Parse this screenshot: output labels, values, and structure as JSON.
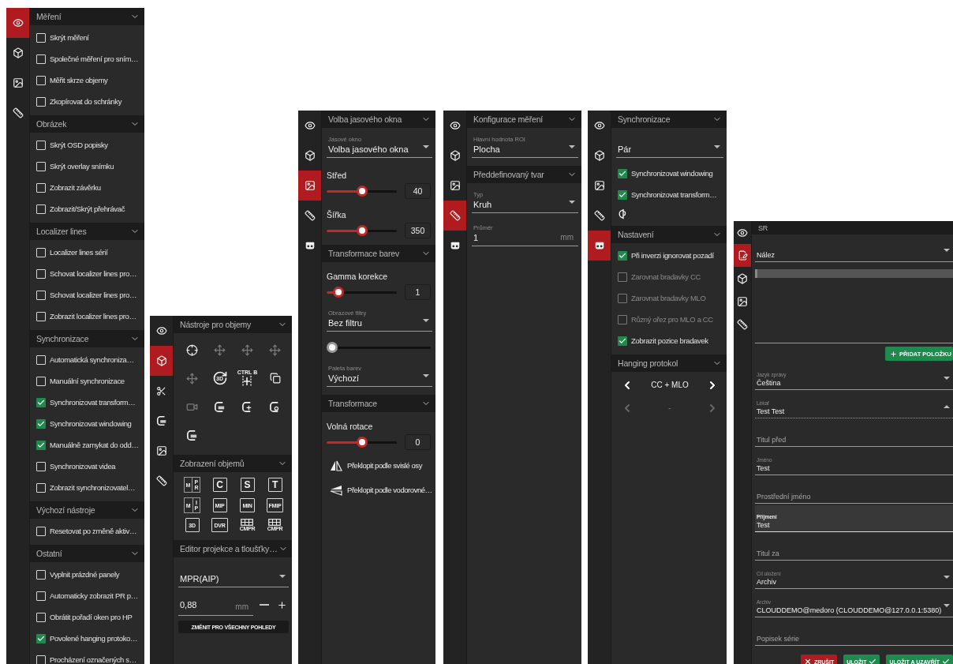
{
  "panels": [
    {
      "kind": "settings",
      "sidebar": [
        {
          "kind": "eye",
          "selected": true
        },
        {
          "kind": "cube",
          "selected": false
        },
        {
          "kind": "image",
          "selected": false
        },
        {
          "kind": "ruler",
          "selected": false
        }
      ],
      "sections": [
        {
          "title": "Měření",
          "items": [
            {
              "kind": "checkbox",
              "label": "Skrýt měření",
              "checked": false
            },
            {
              "kind": "checkbox",
              "label": "Společné měření pro sním…",
              "checked": false
            },
            {
              "kind": "checkbox",
              "label": "Měřit skrze objemy",
              "checked": false
            },
            {
              "kind": "checkbox",
              "label": "Zkopírovat do schránky",
              "checked": false
            }
          ]
        },
        {
          "title": "Obrázek",
          "items": [
            {
              "kind": "checkbox",
              "label": "Skrýt OSD popisky",
              "checked": false
            },
            {
              "kind": "checkbox",
              "label": "Skrýt overlay snímku",
              "checked": false
            },
            {
              "kind": "checkbox",
              "label": "Zobrazit závěrku",
              "checked": false
            },
            {
              "kind": "checkbox",
              "label": "Zobrazit/Skrýt přehrávač",
              "checked": false
            }
          ]
        },
        {
          "title": "Localizer lines",
          "items": [
            {
              "kind": "checkbox",
              "label": "Localizer lines sérií",
              "checked": false
            },
            {
              "kind": "checkbox",
              "label": "Schovat localizer lines pro…",
              "checked": false
            },
            {
              "kind": "checkbox",
              "label": "Schovat localizer lines pro…",
              "checked": false
            },
            {
              "kind": "checkbox",
              "label": "Zobrazit localizer lines pro…",
              "checked": false
            }
          ]
        },
        {
          "title": "Synchronizace",
          "items": [
            {
              "kind": "checkbox",
              "label": "Automatická synchroniza…",
              "checked": false
            },
            {
              "kind": "checkbox",
              "label": "Manuální synchronizace",
              "checked": false
            },
            {
              "kind": "checkbox",
              "label": "Synchronizovat transform…",
              "checked": true
            },
            {
              "kind": "checkbox",
              "label": "Synchronizovat windowing",
              "checked": true
            },
            {
              "kind": "checkbox",
              "label": "Manuálně zamykat do odd…",
              "checked": true
            },
            {
              "kind": "checkbox",
              "label": "Synchronizovat videa",
              "checked": false
            },
            {
              "kind": "checkbox",
              "label": "Zobrazit synchronizovatel…",
              "checked": false
            }
          ]
        },
        {
          "title": "Výchozí nástroje",
          "items": [
            {
              "kind": "checkbox",
              "label": "Resetovat po změně aktiv…",
              "checked": false
            }
          ]
        },
        {
          "title": "Ostatní",
          "items": [
            {
              "kind": "checkbox",
              "label": "Vyplnit prázdné panely",
              "checked": false
            },
            {
              "kind": "checkbox",
              "label": "Automaticky zobrazit PR p…",
              "checked": false
            },
            {
              "kind": "checkbox",
              "label": "Obrátit pořadí oken pro HP",
              "checked": false
            },
            {
              "kind": "checkbox",
              "label": "Povolené hanging protoko…",
              "checked": true
            },
            {
              "kind": "checkbox",
              "label": "Procházení označených s…",
              "checked": false
            }
          ]
        }
      ]
    },
    {
      "kind": "settings",
      "sidebar": [
        {
          "kind": "eye",
          "selected": false
        },
        {
          "kind": "cube",
          "selected": true
        },
        {
          "kind": "scissors",
          "selected": false
        },
        {
          "kind": "bracket",
          "selected": false
        },
        {
          "kind": "image",
          "selected": false
        },
        {
          "kind": "ruler",
          "selected": false
        }
      ],
      "sections": [
        {
          "title": "Nástroje pro objemy",
          "items": [
            {
              "kind": "tools",
              "tools": [
                {
                  "kind": "crosshair",
                  "disabled": false
                },
                {
                  "kind": "move",
                  "disabled": true
                },
                {
                  "kind": "move",
                  "disabled": true
                },
                {
                  "kind": "move",
                  "disabled": true
                },
                {
                  "kind": "move",
                  "disabled": true
                },
                {
                  "kind": "rotate",
                  "text": "3D",
                  "disabled": false
                },
                {
                  "kind": "split",
                  "caption": "CTRL B",
                  "disabled": false
                },
                {
                  "kind": "layers",
                  "disabled": false
                },
                {
                  "kind": "video",
                  "disabled": true
                },
                {
                  "kind": "curve",
                  "disabled": false
                },
                {
                  "kind": "curve",
                  "disabled": false
                },
                {
                  "kind": "curve",
                  "disabled": false
                },
                {
                  "kind": "curve",
                  "disabled": false
                }
              ]
            }
          ]
        },
        {
          "title": "Zobrazení objemů",
          "items": [
            {
              "kind": "tools",
              "tools": [
                {
                  "kind": "stacked",
                  "text": "M",
                  "stack": [
                    "P",
                    "R"
                  ]
                },
                {
                  "kind": "boxed",
                  "text": "C"
                },
                {
                  "kind": "boxed",
                  "text": "S"
                },
                {
                  "kind": "boxed",
                  "text": "T"
                },
                {
                  "kind": "stacked",
                  "text": "M",
                  "stack": [
                    "I",
                    "P"
                  ]
                },
                {
                  "kind": "boxed",
                  "text": "MIP"
                },
                {
                  "kind": "boxed",
                  "text": "MIN"
                },
                {
                  "kind": "boxed",
                  "text": "FMIP"
                },
                {
                  "kind": "boxed",
                  "text": "3D"
                },
                {
                  "kind": "boxed",
                  "text": "DVR"
                },
                {
                  "kind": "grid",
                  "text": "CMPR"
                },
                {
                  "kind": "grid",
                  "text": "CMPR"
                }
              ]
            }
          ]
        },
        {
          "title": "Editor projekce a tloušťky…",
          "items": [
            {
              "kind": "select",
              "value": "MPR(AIP)"
            },
            {
              "kind": "stepper",
              "value": "0,88",
              "unit": "mm"
            },
            {
              "kind": "button",
              "label": "ZMĚNIT PRO VŠECHNY POHLEDY"
            }
          ]
        }
      ]
    },
    {
      "kind": "settings",
      "sidebar": [
        {
          "kind": "eye",
          "selected": false
        },
        {
          "kind": "cube",
          "selected": false
        },
        {
          "kind": "image",
          "selected": true
        },
        {
          "kind": "ruler",
          "selected": false
        },
        {
          "kind": "mask",
          "selected": false
        }
      ],
      "sections": [
        {
          "title": "Volba jasového okna",
          "items": [
            {
              "kind": "select",
              "label": "Jasové okno",
              "value": "Volba jasového okna"
            },
            {
              "kind": "slider",
              "label": "Střed",
              "level": 0.5,
              "value": "40"
            },
            {
              "kind": "slider",
              "label": "Šířka",
              "level": 0.5,
              "value": "350"
            }
          ]
        },
        {
          "title": "Transformace barev",
          "items": [
            {
              "kind": "slider",
              "label": "Gamma korekce",
              "level": 0.1,
              "value": "1"
            },
            {
              "kind": "select",
              "label": "Obrazové filtry",
              "value": "Bez filtru"
            },
            {
              "kind": "slider",
              "level": 0
            },
            {
              "kind": "select",
              "label": "Paleta barev",
              "value": "Výchozí"
            }
          ]
        },
        {
          "title": "Transformace",
          "items": [
            {
              "kind": "slider",
              "label": "Volná rotace",
              "level": 0.5,
              "value": "0"
            },
            {
              "kind": "flip-vertical",
              "label": "Překlopit podle svislé osy"
            },
            {
              "kind": "flip-horizontal",
              "label": "Překlopit podle vodorovné…"
            }
          ]
        }
      ]
    },
    {
      "kind": "settings",
      "sidebar": [
        {
          "kind": "eye",
          "selected": false
        },
        {
          "kind": "cube",
          "selected": false
        },
        {
          "kind": "image",
          "selected": false
        },
        {
          "kind": "ruler",
          "selected": true
        },
        {
          "kind": "mask",
          "selected": false
        }
      ],
      "sections": [
        {
          "title": "Konfigurace měření",
          "items": [
            {
              "kind": "select",
              "label": "Hlavní hodnota ROI",
              "value": "Plocha"
            }
          ]
        },
        {
          "title": "Předdefinovaný tvar",
          "items": [
            {
              "kind": "select",
              "label": "Typ",
              "value": "Kruh"
            },
            {
              "kind": "input",
              "label": "Průměr",
              "value": "1",
              "unit": "mm"
            }
          ]
        }
      ]
    },
    {
      "kind": "settings",
      "sidebar": [
        {
          "kind": "eye",
          "selected": false
        },
        {
          "kind": "cube",
          "selected": false
        },
        {
          "kind": "image",
          "selected": false
        },
        {
          "kind": "ruler",
          "selected": false
        },
        {
          "kind": "mask",
          "selected": true
        }
      ],
      "sections": [
        {
          "title": "Synchronizace",
          "items": [
            {
              "kind": "select",
              "value": "Pár"
            },
            {
              "kind": "checkbox",
              "label": "Synchronizovat windowing",
              "checked": true,
              "disabled": false
            },
            {
              "kind": "checkbox",
              "label": "Synchronizovat transform…",
              "checked": true,
              "disabled": false
            },
            {
              "kind": "sync"
            }
          ]
        },
        {
          "title": "Nastavení",
          "items": [
            {
              "kind": "checkbox",
              "label": "Při inverzi ignorovat pozadí",
              "checked": true,
              "disabled": false
            },
            {
              "kind": "checkbox",
              "label": "Zarovnat bradavky CC",
              "checked": false,
              "disabled": true
            },
            {
              "kind": "checkbox",
              "label": "Zarovnat bradavky MLO",
              "checked": false,
              "disabled": true
            },
            {
              "kind": "checkbox",
              "label": "Různý ořez pro MLO a CC",
              "checked": false,
              "disabled": true
            },
            {
              "kind": "checkbox",
              "label": "Zobrazit pozice bradavek",
              "checked": true,
              "disabled": false
            }
          ]
        },
        {
          "title": "Hanging protokol",
          "items": [
            {
              "kind": "pager",
              "label": "CC + MLO",
              "disabled": false
            },
            {
              "kind": "pager",
              "label": "-",
              "disabled": true
            }
          ]
        }
      ]
    },
    {
      "kind": "report",
      "sidebar": [
        {
          "kind": "eye",
          "selected": false
        },
        {
          "kind": "report",
          "selected": true
        },
        {
          "kind": "cube",
          "selected": false
        },
        {
          "kind": "image",
          "selected": false
        },
        {
          "kind": "ruler",
          "selected": false
        }
      ],
      "sections": [
        {
          "title": "SR",
          "items": [
            {
              "kind": "select",
              "value": "Nález",
              "expanded": false
            },
            {
              "kind": "editor"
            },
            {
              "kind": "add-button",
              "label": "PŘIDAT POLOŽKU"
            },
            {
              "kind": "select",
              "label": "Jazyk zprávy",
              "value": "Čeština",
              "expanded": false
            },
            {
              "kind": "select",
              "label": "Lékař",
              "value": "Test Test",
              "expanded": true
            },
            {
              "kind": "input",
              "placeholder": "Titul před",
              "focused": false
            },
            {
              "kind": "input",
              "label": "Jméno",
              "value": "Test",
              "focused": false
            },
            {
              "kind": "input",
              "placeholder": "Prostřední jméno",
              "focused": false
            },
            {
              "kind": "input",
              "label": "Příjmení",
              "value": "Test",
              "focused": true
            },
            {
              "kind": "input",
              "placeholder": "Titul za",
              "focused": false
            },
            {
              "kind": "select",
              "label": "Cíl uložení",
              "value": "Archiv",
              "expanded": false
            },
            {
              "kind": "select",
              "label": "Archiv",
              "value": "CLOUDDEMO@medoro (CLOUDDEMO@127.0.0.1:5380)",
              "expanded": false
            },
            {
              "kind": "input",
              "placeholder": "Popisek série",
              "focused": false
            },
            {
              "kind": "actions",
              "buttons": [
                {
                  "kind": "cancel",
                  "label": "ZRUŠIT"
                },
                {
                  "kind": "save",
                  "label": "ULOŽIT"
                },
                {
                  "kind": "save",
                  "label": "ULOŽIT A UZAVŘÍT"
                }
              ]
            }
          ]
        }
      ]
    }
  ]
}
